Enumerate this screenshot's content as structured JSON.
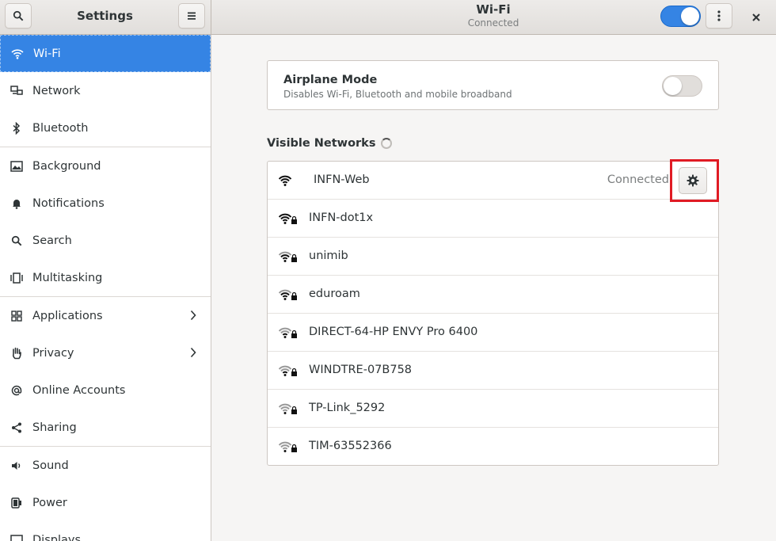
{
  "header": {
    "sidebar_title": "Settings",
    "page_title": "Wi-Fi",
    "page_subtitle": "Connected",
    "wifi_enabled": true,
    "accent_color": "#3584e4"
  },
  "sidebar": {
    "items": [
      {
        "label": "Wi-Fi",
        "icon": "wifi-icon",
        "active": true
      },
      {
        "label": "Network",
        "icon": "network-icon"
      },
      {
        "label": "Bluetooth",
        "icon": "bluetooth-icon"
      },
      {
        "label": "Background",
        "icon": "background-icon"
      },
      {
        "label": "Notifications",
        "icon": "bell-icon"
      },
      {
        "label": "Search",
        "icon": "search-icon"
      },
      {
        "label": "Multitasking",
        "icon": "multitasking-icon"
      },
      {
        "label": "Applications",
        "icon": "grid-icon",
        "chevron": true
      },
      {
        "label": "Privacy",
        "icon": "hand-icon",
        "chevron": true
      },
      {
        "label": "Online Accounts",
        "icon": "at-icon"
      },
      {
        "label": "Sharing",
        "icon": "share-icon"
      },
      {
        "label": "Sound",
        "icon": "speaker-icon"
      },
      {
        "label": "Power",
        "icon": "power-plug-icon"
      },
      {
        "label": "Displays",
        "icon": "display-icon"
      }
    ]
  },
  "airplane": {
    "title": "Airplane Mode",
    "subtitle": "Disables Wi-Fi, Bluetooth and mobile broadband",
    "enabled": false
  },
  "networks": {
    "heading": "Visible Networks",
    "items": [
      {
        "name": "INFN-Web",
        "status": "Connected",
        "secured": false,
        "signal": 4
      },
      {
        "name": "INFN-dot1x",
        "secured": true,
        "signal": 4
      },
      {
        "name": "unimib",
        "secured": true,
        "signal": 3
      },
      {
        "name": "eduroam",
        "secured": true,
        "signal": 3
      },
      {
        "name": "DIRECT-64-HP ENVY Pro 6400",
        "secured": true,
        "signal": 2
      },
      {
        "name": "WINDTRE-07B758",
        "secured": true,
        "signal": 2
      },
      {
        "name": "TP-Link_5292",
        "secured": true,
        "signal": 1
      },
      {
        "name": "TIM-63552366",
        "secured": true,
        "signal": 1
      }
    ]
  }
}
